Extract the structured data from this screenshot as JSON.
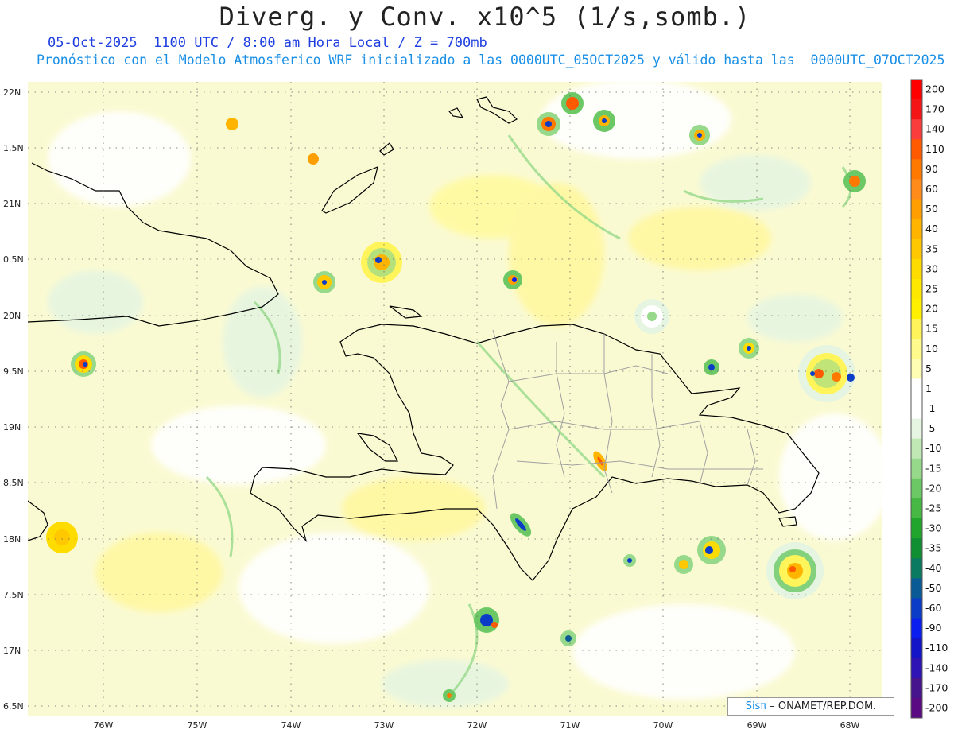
{
  "header": {
    "title": "Diverg. y Conv. x10^5 (1/s,somb.)",
    "subtitle_line1": "05-Oct-2025  1100 UTC / 8:00 am Hora Local / Z = 700mb",
    "subtitle_line2": "Pronóstico con el Modelo Atmosferico WRF inicializado a las 0000UTC_05OCT2025 y válido hasta las  0000UTC_07OCT2025"
  },
  "axes": {
    "lat_labels": [
      "22N",
      "1.5N",
      "21N",
      "0.5N",
      "20N",
      "9.5N",
      "19N",
      "8.5N",
      "18N",
      "7.5N",
      "17N",
      "6.5N"
    ],
    "lon_labels": [
      "76W",
      "75W",
      "74W",
      "73W",
      "72W",
      "71W",
      "70W",
      "69W",
      "68W"
    ]
  },
  "colorbar": {
    "labels": [
      "200",
      "170",
      "140",
      "110",
      "90",
      "60",
      "50",
      "40",
      "35",
      "30",
      "25",
      "20",
      "15",
      "10",
      "5",
      "1",
      "-1",
      "-5",
      "-10",
      "-15",
      "-20",
      "-25",
      "-30",
      "-35",
      "-40",
      "-50",
      "-60",
      "-90",
      "-110",
      "-140",
      "-170",
      "-200"
    ],
    "colors": [
      "#ff0000",
      "#f41616",
      "#fa3c3c",
      "#ff5a00",
      "#ff7800",
      "#ff8c1a",
      "#ff9e00",
      "#ffb400",
      "#ffc800",
      "#ffdc00",
      "#ffe800",
      "#fff000",
      "#fff55a",
      "#fffa8c",
      "#fffcb4",
      "#ffffff",
      "#ffffff",
      "#e6f5e1",
      "#bfe8b4",
      "#96d98a",
      "#6cc864",
      "#48b844",
      "#22a52d",
      "#0f8f32",
      "#0a7a60",
      "#0a5a96",
      "#0a3cc8",
      "#0a1ef0",
      "#1414c8",
      "#2e14b4",
      "#46148c",
      "#5a0a82"
    ]
  },
  "credit": {
    "logo": "Sisπ",
    "text": " – ONAMET/REP.DOM."
  }
}
